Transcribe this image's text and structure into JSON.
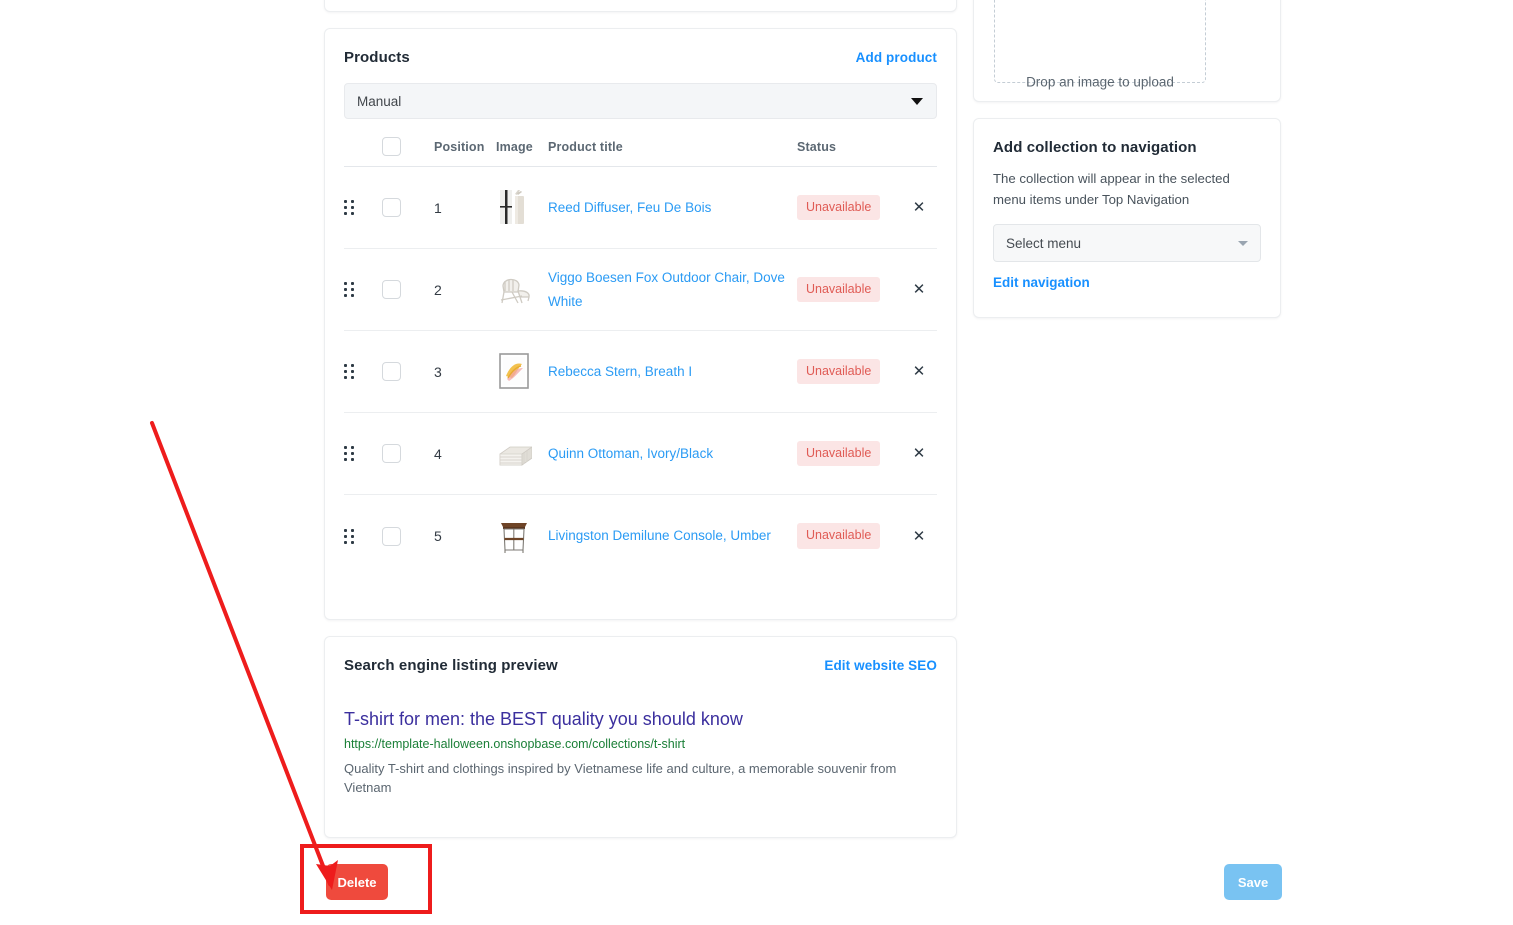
{
  "products_card": {
    "title": "Products",
    "add_product_label": "Add product",
    "sort_select_value": "Manual",
    "columns": {
      "position": "Position",
      "image": "Image",
      "product_title": "Product title",
      "status": "Status"
    },
    "rows": [
      {
        "position": "1",
        "title": "Reed Diffuser, Feu De Bois",
        "status": "Unavailable",
        "remove": "✕",
        "thumb": "reed-diffuser-thumbnail"
      },
      {
        "position": "2",
        "title": "Viggo Boesen Fox Outdoor Chair, Dove White",
        "status": "Unavailable",
        "remove": "✕",
        "thumb": "outdoor-chair-thumbnail"
      },
      {
        "position": "3",
        "title": "Rebecca Stern, Breath I",
        "status": "Unavailable",
        "remove": "✕",
        "thumb": "framed-art-thumbnail"
      },
      {
        "position": "4",
        "title": "Quinn Ottoman, Ivory/Black",
        "status": "Unavailable",
        "remove": "✕",
        "thumb": "ottoman-thumbnail"
      },
      {
        "position": "5",
        "title": "Livingston Demilune Console, Umber",
        "status": "Unavailable",
        "remove": "✕",
        "thumb": "console-table-thumbnail"
      }
    ]
  },
  "seo_card": {
    "title": "Search engine listing preview",
    "edit_link": "Edit website SEO",
    "result_title": "T-shirt for men: the BEST quality you should know",
    "result_url": "https://template-halloween.onshopbase.com/collections/t-shirt",
    "result_description": "Quality T-shirt and clothings inspired by Vietnamese life and culture, a memorable souvenir from Vietnam"
  },
  "upload_card": {
    "dropzone_text": "Drop an image to upload"
  },
  "navigation_card": {
    "title": "Add collection to navigation",
    "description": "The collection will appear in the selected menu items under Top Navigation",
    "select_menu_value": "Select menu",
    "edit_navigation_label": "Edit navigation"
  },
  "footer": {
    "delete_label": "Delete",
    "save_label": "Save"
  },
  "colors": {
    "link_blue": "#1890ff",
    "product_link_blue": "#2b9bf4",
    "badge_bg": "#fbe5e5",
    "badge_text": "#e05b55",
    "delete_red": "#ef4a3d",
    "save_blue": "#79c3f2",
    "annotation_red": "#ee1c1c",
    "seo_title_purple": "#3b2f9e",
    "seo_url_green": "#1a7f37"
  }
}
